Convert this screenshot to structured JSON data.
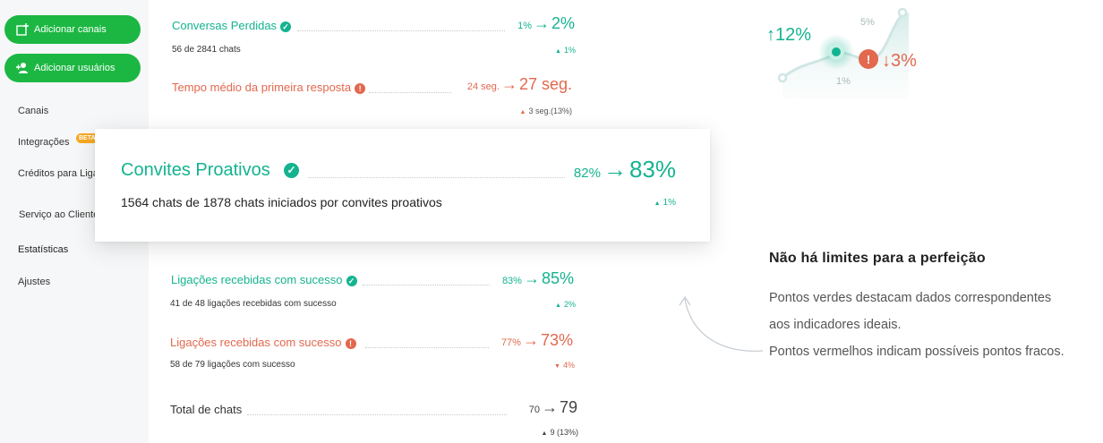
{
  "sidebar": {
    "add_channels_label": "Adicionar canais",
    "add_users_label": "Adicionar usuários",
    "items": [
      {
        "label": "Canais"
      },
      {
        "label": "Integrações",
        "badge": "BETA"
      },
      {
        "label": "Créditos para Liga"
      },
      {
        "label": "Serviço ao Cliente"
      },
      {
        "label": "Estatísticas"
      },
      {
        "label": "Ajustes"
      }
    ]
  },
  "metrics": {
    "lost_chats": {
      "title": "Conversas Perdidas",
      "subtitle": "56 de 2841 chats",
      "from": "1%",
      "arrow": "→",
      "to": "2%",
      "change": "1%",
      "status": "good"
    },
    "first_response": {
      "title": "Tempo médio da primeira resposta",
      "from": "24 seg.",
      "arrow": "→",
      "to": "27 seg.",
      "change": "3 seg.(13%)",
      "status": "bad"
    },
    "proactive": {
      "title": "Convites Proativos",
      "subtitle": "1564 chats de 1878 chats iniciados por convites proativos",
      "from": "82%",
      "arrow": "→",
      "to": "83%",
      "change": "1%",
      "status": "good"
    },
    "calls_good": {
      "title": "Ligações recebidas com sucesso",
      "subtitle": "41 de 48 ligações recebidas com sucesso",
      "from": "83%",
      "arrow": "→",
      "to": "85%",
      "change": "2%",
      "status": "good"
    },
    "calls_bad": {
      "title": "Ligações recebidas com sucesso",
      "subtitle": "58 de 79 ligações com sucesso",
      "from": "77%",
      "arrow": "→",
      "to": "73%",
      "change": "4%",
      "status": "bad"
    },
    "total_chats": {
      "title": "Total de chats",
      "from": "70",
      "arrow": "→",
      "to": "79",
      "change": "9 (13%)"
    }
  },
  "illustration": {
    "up_label": "↑12%",
    "down_label": "↓3%",
    "top_label": "5%",
    "bottom_label": "1%",
    "alert_glyph": "!"
  },
  "panel": {
    "title": "Não há limites para a perfeição",
    "line1": "Pontos verdes destacam dados correspondentes",
    "line2": "aos indicadores ideais.",
    "line3": "Pontos vermelhos indicam possíveis pontos fracos."
  },
  "glyphs": {
    "up": "▲",
    "down": "▼",
    "check": "✓",
    "alert": "!"
  },
  "colors": {
    "accent_green": "#1cb743",
    "good": "#14b390",
    "bad": "#e2684e",
    "beta": "#f7a823"
  }
}
